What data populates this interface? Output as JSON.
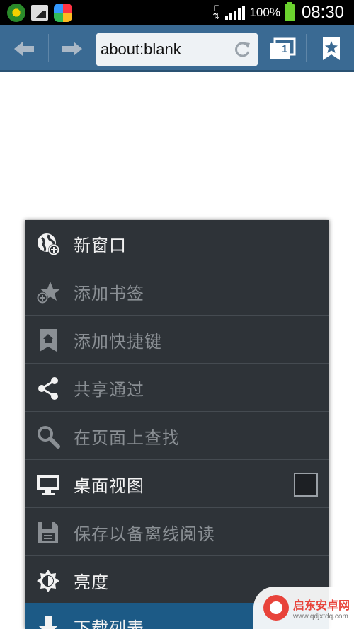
{
  "status_bar": {
    "network_type": "E",
    "battery_percent": "100%",
    "time": "08:30",
    "notification_icons": [
      "clover-icon",
      "gallery-icon",
      "app-store-icon"
    ]
  },
  "toolbar": {
    "url": "about:blank",
    "tab_count": "1"
  },
  "menu": {
    "items": [
      {
        "label": "新窗口",
        "icon": "globe-add-icon",
        "enabled": true
      },
      {
        "label": "添加书签",
        "icon": "star-add-icon",
        "enabled": false
      },
      {
        "label": "添加快捷键",
        "icon": "home-bookmark-icon",
        "enabled": false
      },
      {
        "label": "共享通过",
        "icon": "share-icon",
        "enabled": false
      },
      {
        "label": "在页面上查找",
        "icon": "search-icon",
        "enabled": false
      },
      {
        "label": "桌面视图",
        "icon": "monitor-icon",
        "enabled": true,
        "checkbox": false
      },
      {
        "label": "保存以备离线阅读",
        "icon": "save-icon",
        "enabled": false
      },
      {
        "label": "亮度",
        "icon": "brightness-icon",
        "enabled": true
      },
      {
        "label": "下载列表",
        "icon": "download-icon",
        "enabled": true,
        "selected": true
      }
    ]
  },
  "watermark": {
    "title": "启东安卓网",
    "url": "www.qdjxtdq.com"
  },
  "colors": {
    "toolbar": "#3a6a93",
    "menu_bg": "#2e3338",
    "menu_selected": "#1c5a86",
    "text_enabled": "#f2f2f2",
    "text_disabled": "#8a8f94"
  }
}
